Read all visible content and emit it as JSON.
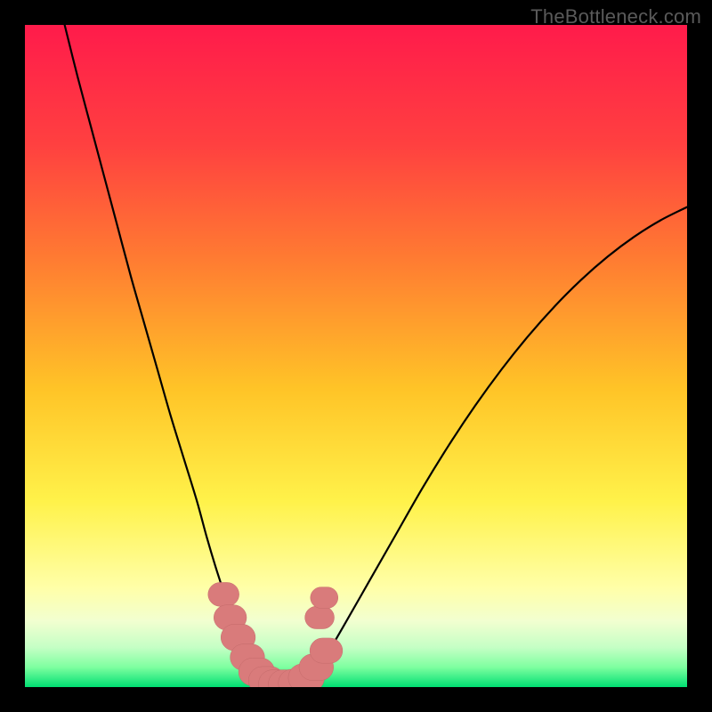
{
  "watermark": "TheBottleneck.com",
  "colors": {
    "frame": "#000000",
    "gradient_top": "#ff1b4b",
    "gradient_mid_upper": "#ff6a38",
    "gradient_mid": "#ffd02c",
    "gradient_mid_lower": "#ffff63",
    "gradient_low": "#f6ffb8",
    "gradient_near_bottom": "#9fffb0",
    "gradient_bottom": "#00e070",
    "curve": "#000000",
    "marker_fill": "#d97b7b",
    "marker_stroke": "#c46a6a"
  },
  "chart_data": {
    "type": "line",
    "title": "",
    "xlabel": "",
    "ylabel": "",
    "xlim": [
      0,
      100
    ],
    "ylim": [
      0,
      100
    ],
    "series": [
      {
        "name": "curve-left",
        "x": [
          6,
          8,
          10,
          12,
          14,
          16,
          18,
          20,
          22,
          24,
          26,
          27.5,
          29,
          30.5,
          32,
          33.5,
          35,
          36.5
        ],
        "y": [
          100,
          92,
          84.5,
          77,
          69.5,
          62,
          55,
          48,
          41,
          34.5,
          28,
          22.5,
          17.5,
          13,
          9,
          5.5,
          2.5,
          0.5
        ]
      },
      {
        "name": "curve-right",
        "x": [
          42,
          45,
          48,
          52,
          56,
          60,
          64,
          68,
          72,
          76,
          80,
          84,
          88,
          92,
          96,
          100
        ],
        "y": [
          0.5,
          4,
          9,
          16,
          23,
          30,
          36.5,
          42.5,
          48,
          53,
          57.5,
          61.5,
          65,
          68,
          70.5,
          72.5
        ]
      },
      {
        "name": "valley-floor",
        "x": [
          36.5,
          38,
          39.5,
          41,
          42
        ],
        "y": [
          0.5,
          0,
          0,
          0,
          0.5
        ]
      }
    ],
    "markers": [
      {
        "x": 30.0,
        "y": 14,
        "r": 1.8
      },
      {
        "x": 31.0,
        "y": 10.5,
        "r": 1.9
      },
      {
        "x": 32.2,
        "y": 7.5,
        "r": 2.0
      },
      {
        "x": 33.6,
        "y": 4.5,
        "r": 2.0
      },
      {
        "x": 35.0,
        "y": 2.3,
        "r": 2.1
      },
      {
        "x": 36.5,
        "y": 1.0,
        "r": 2.1
      },
      {
        "x": 38.0,
        "y": 0.5,
        "r": 2.1
      },
      {
        "x": 39.5,
        "y": 0.5,
        "r": 2.1
      },
      {
        "x": 41.0,
        "y": 0.6,
        "r": 2.1
      },
      {
        "x": 42.5,
        "y": 1.4,
        "r": 2.1
      },
      {
        "x": 44.0,
        "y": 3.0,
        "r": 2.0
      },
      {
        "x": 45.5,
        "y": 5.5,
        "r": 1.9
      },
      {
        "x": 44.5,
        "y": 10.5,
        "r": 1.7
      },
      {
        "x": 45.2,
        "y": 13.5,
        "r": 1.6
      }
    ],
    "gradient_stops": [
      {
        "pct": 0,
        "color": "#ff1b4b"
      },
      {
        "pct": 18,
        "color": "#ff4040"
      },
      {
        "pct": 35,
        "color": "#ff7a32"
      },
      {
        "pct": 55,
        "color": "#ffc427"
      },
      {
        "pct": 72,
        "color": "#fff24a"
      },
      {
        "pct": 85,
        "color": "#ffffa8"
      },
      {
        "pct": 90,
        "color": "#f2ffd0"
      },
      {
        "pct": 94,
        "color": "#c5ffc5"
      },
      {
        "pct": 97,
        "color": "#7effa0"
      },
      {
        "pct": 100,
        "color": "#00df72"
      }
    ]
  }
}
